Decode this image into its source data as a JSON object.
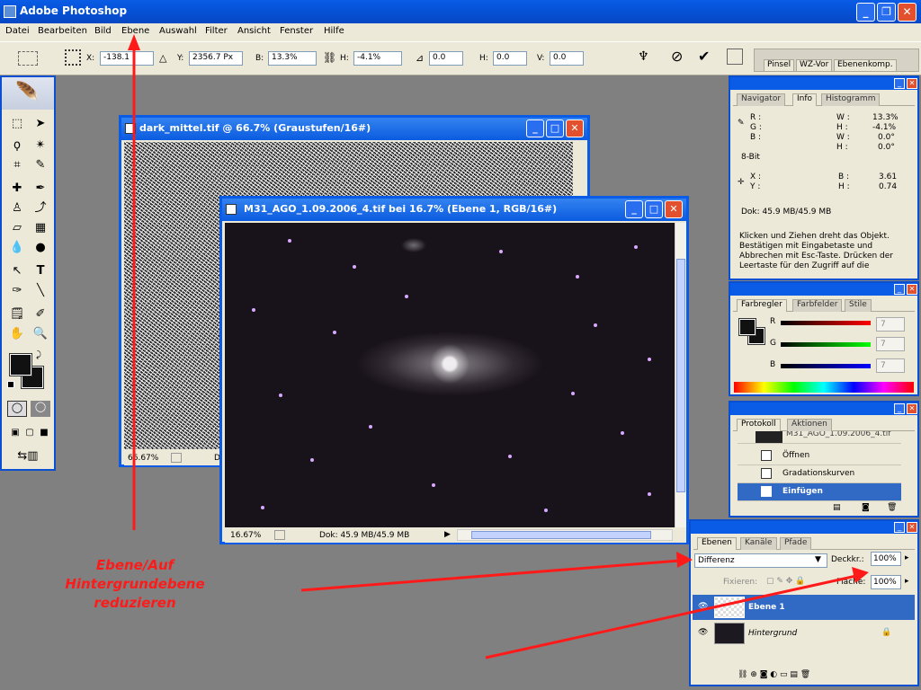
{
  "app": {
    "title": "Adobe Photoshop"
  },
  "menu": [
    "Datei",
    "Bearbeiten",
    "Bild",
    "Ebene",
    "Auswahl",
    "Filter",
    "Ansicht",
    "Fenster",
    "Hilfe"
  ],
  "options": {
    "x_label": "X:",
    "x_value": "-138.1",
    "y_label": "Y:",
    "y_value": "2356.7 Px",
    "b_label": "B:",
    "b_value": "13.3%",
    "h_label": "H:",
    "h_value": "-4.1%",
    "angle_value": "0.0",
    "hskew_label": "H:",
    "hskew_value": "0.0",
    "vskew_label": "V:",
    "vskew_value": "0.0",
    "palette_tabs": [
      "Pinsel",
      "WZ-Vor",
      "Ebenenkomp."
    ]
  },
  "doc1": {
    "title": "dark_mittel.tif @ 66.7% (Graustufen/16#)",
    "zoom": "66.67%",
    "status": "Dok"
  },
  "doc2": {
    "title": "M31_AGO_1.09.2006_4.tif bei 16.7% (Ebene 1, RGB/16#)",
    "zoom": "16.67%",
    "status": "Dok: 45.9 MB/45.9 MB"
  },
  "info_panel": {
    "tabs": [
      "Navigator",
      "Info",
      "Histogramm"
    ],
    "r": "R :",
    "g": "G :",
    "b": "B :",
    "w_label": "W :",
    "w_value": "13.3%",
    "h_label": "H :",
    "h_value": "-4.1%",
    "aw_label": "W :",
    "aw_value": "0.0°",
    "ah_label": "H :",
    "ah_value": "0.0°",
    "bit": "8-Bit",
    "x": "X :",
    "y": "Y :",
    "b2_label": "B :",
    "b2_value": "3.61",
    "h2_label": "H :",
    "h2_value": "0.74",
    "doc": "Dok: 45.9 MB/45.9 MB",
    "hint": "Klicken und Ziehen dreht das Objekt. Bestätigen mit Eingabetaste und Abbrechen mit Esc-Taste. Drücken der Leertaste für den Zugriff auf die"
  },
  "color_panel": {
    "tabs": [
      "Farbregler",
      "Farbfelder",
      "Stile"
    ],
    "r_label": "R",
    "g_label": "G",
    "b_label": "B",
    "r_value": "7",
    "g_value": "7",
    "b_value": "7"
  },
  "history_panel": {
    "tabs": [
      "Protokoll",
      "Aktionen"
    ],
    "snapshot": "M31_AGO_1.09.2006_4.tif",
    "items": [
      "Öffnen",
      "Gradationskurven",
      "Einfügen"
    ]
  },
  "layers_panel": {
    "tabs": [
      "Ebenen",
      "Kanäle",
      "Pfade"
    ],
    "blend_mode": "Differenz",
    "opacity_label": "Deckkr.:",
    "opacity_value": "100%",
    "lock_label": "Fixieren:",
    "fill_label": "Fläche:",
    "fill_value": "100%",
    "layers": [
      "Ebene 1",
      "Hintergrund"
    ]
  },
  "annotation": {
    "line1": "Ebene/Auf",
    "line2": "Hintergrundebene",
    "line3": "reduzieren"
  },
  "colors": {
    "annotation": "#ff1a1a",
    "titlebar": "#0a5ce6",
    "selection": "#316ac5"
  }
}
